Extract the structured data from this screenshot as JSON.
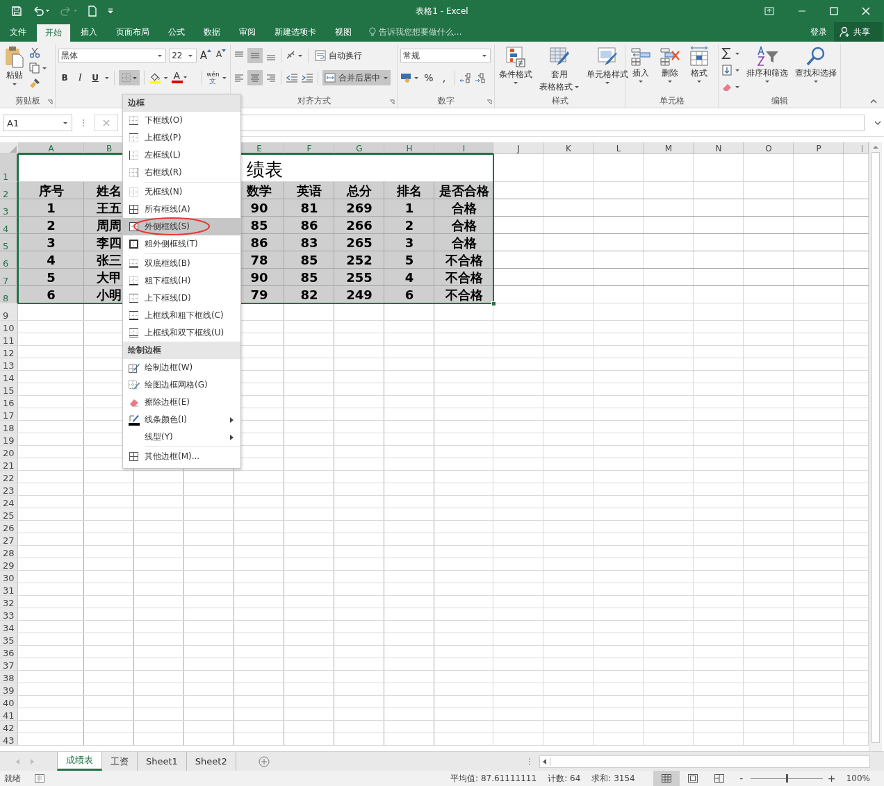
{
  "window": {
    "title": "表格1 - Excel"
  },
  "ribbon_tabs": [
    {
      "label": "文件",
      "selected": false
    },
    {
      "label": "开始",
      "selected": true
    },
    {
      "label": "插入",
      "selected": false
    },
    {
      "label": "页面布局",
      "selected": false
    },
    {
      "label": "公式",
      "selected": false
    },
    {
      "label": "数据",
      "selected": false
    },
    {
      "label": "审阅",
      "selected": false
    },
    {
      "label": "新建选项卡",
      "selected": false
    },
    {
      "label": "视图",
      "selected": false
    }
  ],
  "tell_me": {
    "placeholder": "告诉我您想要做什么..."
  },
  "account": {
    "sign_in": "登录",
    "share": "共享"
  },
  "ribbon": {
    "clipboard": {
      "paste": "粘贴",
      "label": "剪贴板"
    },
    "font": {
      "name": "黑体",
      "size": "22",
      "grow": "A",
      "shrink": "A",
      "bold": "B",
      "italic": "I",
      "underline": "U",
      "font_color_letter": "A",
      "phonetic": "wén",
      "phonetic_char": "文"
    },
    "alignment": {
      "wrap": "自动换行",
      "merge": "合并后居中",
      "label": "对齐方式"
    },
    "number": {
      "format": "常规",
      "percent": "%",
      "comma": ",",
      "label": "数字"
    },
    "styles": {
      "conditional": "条件格式",
      "table_top": "套用",
      "table_bottom": "表格格式",
      "cell_styles": "单元格样式",
      "label": "样式"
    },
    "cells": {
      "insert": "插入",
      "delete": "删除",
      "format": "格式",
      "label": "单元格"
    },
    "editing": {
      "sort": "排序和筛选",
      "find": "查找和选择",
      "label": "编辑"
    }
  },
  "formula_bar": {
    "name_box": "A1"
  },
  "sheet": {
    "columns": [
      "A",
      "B",
      "E",
      "F",
      "G",
      "H",
      "I",
      "J",
      "K",
      "L",
      "M",
      "N",
      "O",
      "P"
    ],
    "row_numbers": [
      "1",
      "2",
      "3",
      "4",
      "5",
      "6",
      "7",
      "8",
      "9",
      "10",
      "11",
      "12",
      "13",
      "14",
      "15",
      "16",
      "17",
      "18",
      "19",
      "20",
      "21",
      "22",
      "23",
      "24",
      "25",
      "26",
      "27",
      "28",
      "29",
      "30",
      "31",
      "32",
      "33",
      "34",
      "35",
      "36",
      "37",
      "38",
      "39",
      "40",
      "41",
      "42",
      "43"
    ],
    "title": "绩表",
    "header": [
      "序号",
      "姓名",
      "数学",
      "英语",
      "总分",
      "排名",
      "是否合格"
    ],
    "rows": [
      [
        "1",
        "王五",
        "90",
        "81",
        "269",
        "1",
        "合格"
      ],
      [
        "2",
        "周周",
        "85",
        "86",
        "266",
        "2",
        "合格"
      ],
      [
        "3",
        "李四",
        "86",
        "83",
        "265",
        "3",
        "合格"
      ],
      [
        "4",
        "张三",
        "78",
        "85",
        "252",
        "5",
        "不合格"
      ],
      [
        "5",
        "大甲",
        "90",
        "85",
        "255",
        "4",
        "不合格"
      ],
      [
        "6",
        "小明",
        "79",
        "82",
        "249",
        "6",
        "不合格"
      ]
    ]
  },
  "border_menu": {
    "sections": [
      {
        "title": "边框",
        "groups": [
          [
            {
              "label": "下框线(O)",
              "selected": false
            },
            {
              "label": "上框线(P)",
              "selected": false
            },
            {
              "label": "左框线(L)",
              "selected": false
            },
            {
              "label": "右框线(R)",
              "selected": false
            }
          ],
          [
            {
              "label": "无框线(N)",
              "selected": false
            },
            {
              "label": "所有框线(A)",
              "selected": false
            },
            {
              "label": "外侧框线(S)",
              "selected": true,
              "circled": true
            },
            {
              "label": "粗外侧框线(T)",
              "selected": false
            }
          ],
          [
            {
              "label": "双底框线(B)",
              "selected": false
            },
            {
              "label": "粗下框线(H)",
              "selected": false
            },
            {
              "label": "上下框线(D)",
              "selected": false
            },
            {
              "label": "上框线和粗下框线(C)",
              "selected": false
            },
            {
              "label": "上框线和双下框线(U)",
              "selected": false
            }
          ]
        ]
      },
      {
        "title": "绘制边框",
        "groups": [
          [
            {
              "label": "绘制边框(W)",
              "selected": false
            },
            {
              "label": "绘图边框网格(G)",
              "selected": false
            },
            {
              "label": "擦除边框(E)",
              "selected": false
            },
            {
              "label": "线条颜色(I)",
              "selected": false,
              "submenu": true
            },
            {
              "label": "线型(Y)",
              "selected": false,
              "submenu": true
            }
          ],
          [
            {
              "label": "其他边框(M)...",
              "selected": false
            }
          ]
        ]
      }
    ]
  },
  "sheet_tabs": [
    {
      "label": "成绩表",
      "selected": true
    },
    {
      "label": "工资",
      "selected": false
    },
    {
      "label": "Sheet1",
      "selected": false
    },
    {
      "label": "Sheet2",
      "selected": false
    }
  ],
  "status_bar": {
    "state": "就绪",
    "average": "平均值: 87.61111111",
    "count": "计数: 64",
    "sum": "求和: 3154",
    "views": [
      {
        "selected": true
      },
      {
        "selected": false
      },
      {
        "selected": false
      }
    ],
    "zoom_minus": "-",
    "zoom_plus": "+",
    "zoom": {
      "level": 0.5
    },
    "zoom_percent": "100%"
  }
}
